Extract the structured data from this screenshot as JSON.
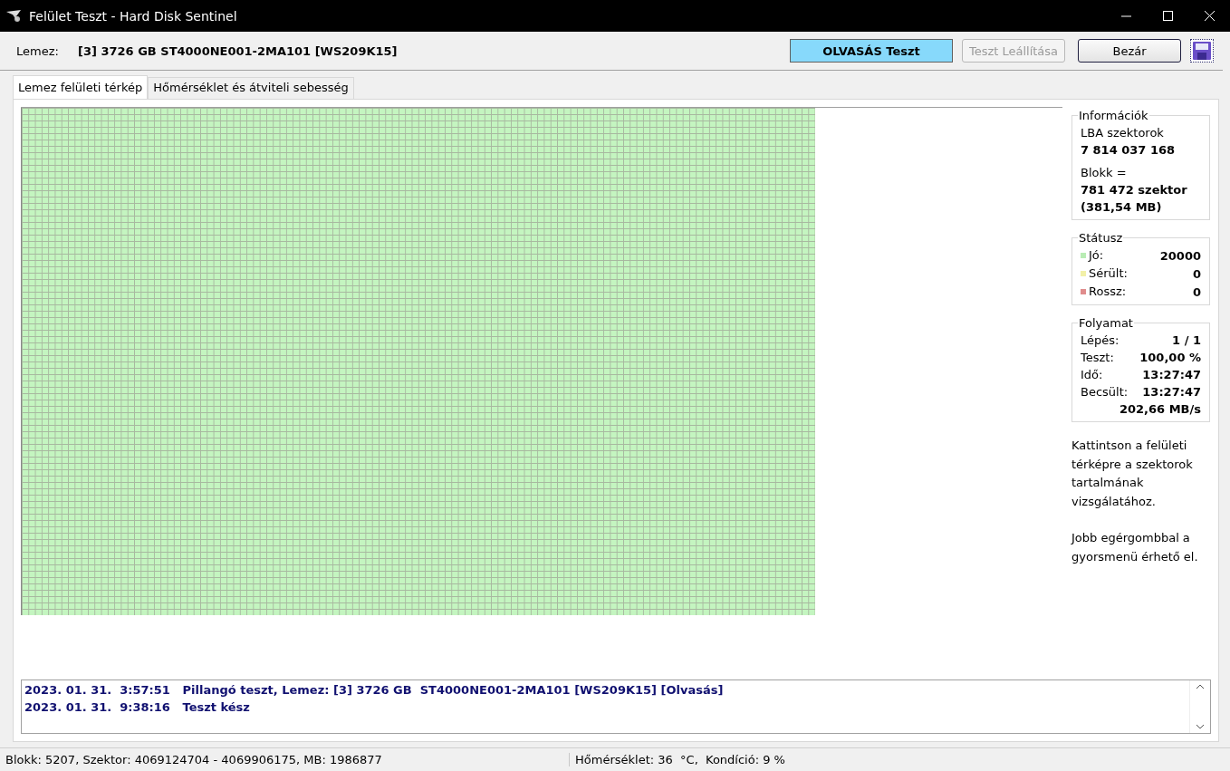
{
  "window": {
    "title": "Felület Teszt - Hard Disk Sentinel"
  },
  "header": {
    "disk_label": "Lemez:",
    "disk_value": "[3] 3726 GB  ST4000NE001-2MA101 [WS209K15]",
    "buttons": [
      {
        "kind": "status",
        "label": "OLVASÁS Teszt",
        "disabled": false
      },
      {
        "kind": "push",
        "label": "Teszt Leállítása",
        "disabled": true
      },
      {
        "kind": "push",
        "label": "Bezár",
        "disabled": false
      },
      {
        "kind": "save",
        "disabled": false
      }
    ]
  },
  "tabs": [
    {
      "label": "Lemez felületi térkép",
      "selected": true
    },
    {
      "label": "Hőmérséklet és átviteli sebesség",
      "selected": false
    }
  ],
  "info": {
    "title": "Információk",
    "lba_label": "LBA szektorok",
    "lba_value": "7 814 037 168",
    "block_label": "Blokk =",
    "block_value": "781 472 szektor",
    "block_size": "(381,54 MB)"
  },
  "status": {
    "title": "Státusz",
    "items": [
      {
        "label": "Jó:",
        "value": "20000",
        "color": "#b9ecb4"
      },
      {
        "label": "Sérült:",
        "value": "0",
        "color": "#f2f0a8"
      },
      {
        "label": "Rossz:",
        "value": "0",
        "color": "#e08c8c"
      }
    ]
  },
  "progress": {
    "title": "Folyamat",
    "rows": [
      {
        "label": "Lépés:",
        "value": "1 / 1"
      },
      {
        "label": "Teszt:",
        "value": "100,00 %"
      },
      {
        "label": "Idő:",
        "value": "13:27:47"
      },
      {
        "label": "Becsült:",
        "value": "13:27:47"
      },
      {
        "value": "202,66 MB/s"
      }
    ]
  },
  "hints": [
    "Kattintson a felületi térképre a szektorok tartalmának vizsgálatához.",
    "Jobb egérgombbal a gyorsmenü érhető el."
  ],
  "log": [
    "2023. 01. 31.  3:57:51   Pillangó teszt, Lemez: [3] 3726 GB  ST4000NE001-2MA101 [WS209K15] [Olvasás]",
    "2023. 01. 31.  9:38:16   Teszt kész"
  ],
  "status_bar": [
    "Blokk: 5207, Szektor: 4069124704 - 4069906175, MB: 1986877",
    "Hőmérséklet: 36  °C,  Kondíció: 9 %"
  ]
}
